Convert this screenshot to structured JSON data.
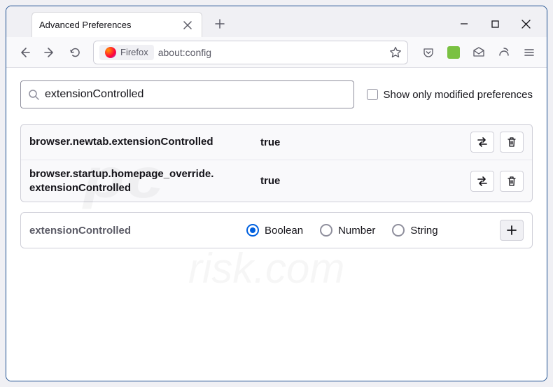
{
  "tab": {
    "title": "Advanced Preferences"
  },
  "urlbar": {
    "identity_label": "Firefox",
    "url": "about:config"
  },
  "search": {
    "value": "extensionControlled",
    "show_modified_label": "Show only modified preferences"
  },
  "prefs": [
    {
      "name": "browser.newtab.extensionControlled",
      "value": "true"
    },
    {
      "name": "browser.startup.homepage_override.extensionControlled",
      "value": "true"
    }
  ],
  "add_row": {
    "name": "extensionControlled",
    "types": {
      "boolean": "Boolean",
      "number": "Number",
      "string": "String"
    },
    "selected": "boolean"
  },
  "watermark": {
    "line1": "pc",
    "line2": "risk.com"
  }
}
